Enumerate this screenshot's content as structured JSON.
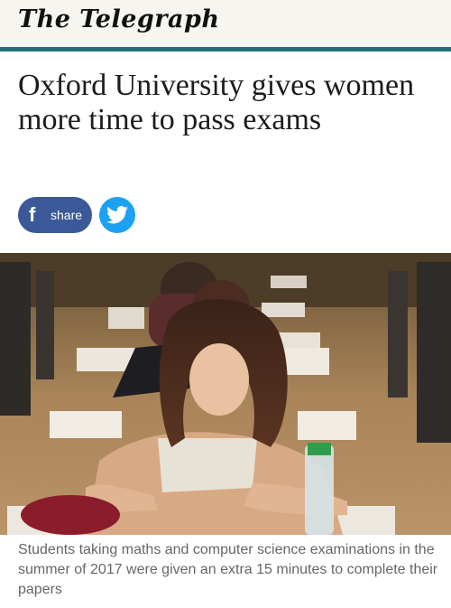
{
  "masthead": {
    "logo_text": "The Telegraph"
  },
  "article": {
    "headline": "Oxford University gives women more time to pass exams"
  },
  "share": {
    "facebook_label": "share",
    "facebook_icon": "facebook-icon",
    "twitter_icon": "twitter-icon",
    "facebook_color": "#3b5998",
    "twitter_color": "#1da1f2"
  },
  "image": {
    "caption": "Students taking maths and computer science examinations in the summer of 2017 were given an extra 15 minutes to complete their papers"
  },
  "colors": {
    "accent_rule": "#22717b",
    "masthead_bg": "#f7f5f0"
  }
}
